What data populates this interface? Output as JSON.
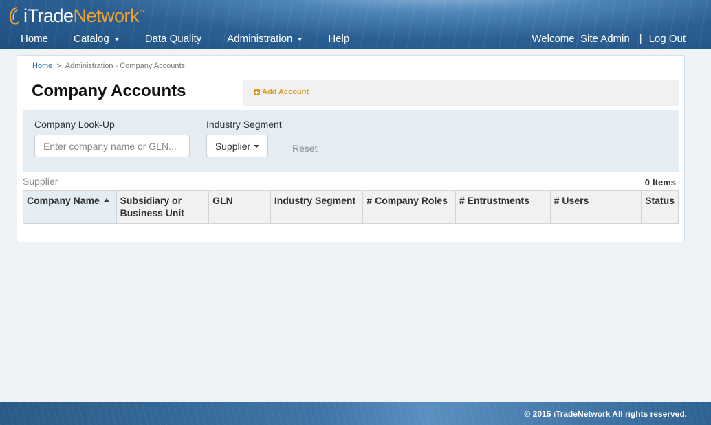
{
  "brand": {
    "logo_prefix": "iTrade",
    "logo_suffix": "Network",
    "trademark": "™",
    "accent_color": "#f0a32a"
  },
  "nav": {
    "items": [
      {
        "label": "Home",
        "dropdown": false
      },
      {
        "label": "Catalog",
        "dropdown": true
      },
      {
        "label": "Data Quality",
        "dropdown": false
      },
      {
        "label": "Administration",
        "dropdown": true
      },
      {
        "label": "Help",
        "dropdown": false
      }
    ]
  },
  "user": {
    "welcome": "Welcome",
    "name": "Site Admin",
    "separator": "|",
    "logout": "Log Out"
  },
  "breadcrumb": {
    "home": "Home",
    "separator": ">",
    "current": "Administration - Company Accounts"
  },
  "page": {
    "title": "Company Accounts",
    "add_account": "Add Account"
  },
  "filters": {
    "lookup_label": "Company Look-Up",
    "lookup_placeholder": "Enter company name or GLN...",
    "lookup_value": "",
    "segment_label": "Industry Segment",
    "segment_value": "Supplier",
    "reset": "Reset"
  },
  "list": {
    "caption": "Supplier",
    "count": "0",
    "count_suffix": "Items",
    "columns": [
      {
        "label": "Company Name",
        "sorted": "asc"
      },
      {
        "label": "Subsidiary or Business Unit"
      },
      {
        "label": "GLN"
      },
      {
        "label": "Industry Segment"
      },
      {
        "label": "# Company Roles"
      },
      {
        "label": "# Entrustments"
      },
      {
        "label": "# Users"
      },
      {
        "label": "Status"
      }
    ],
    "rows": []
  },
  "footer": {
    "copyright": "© 2015 iTradeNetwork All rights reserved."
  }
}
